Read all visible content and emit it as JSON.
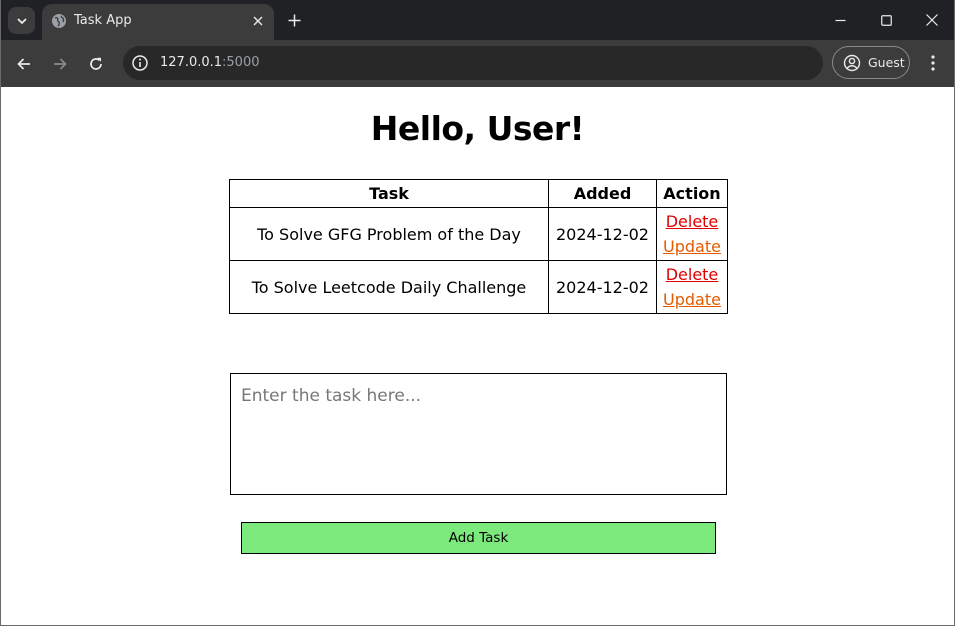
{
  "browser": {
    "tab": {
      "title": "Task App"
    },
    "address_bar": {
      "host": "127.0.0.1",
      "port": ":5000"
    },
    "profile": {
      "label": "Guest"
    }
  },
  "page": {
    "heading": "Hello, User!",
    "table": {
      "headers": [
        "Task",
        "Added",
        "Action"
      ],
      "rows": [
        {
          "task": "To Solve GFG Problem of the Day",
          "added": "2024-12-02",
          "delete_label": "Delete",
          "update_label": "Update"
        },
        {
          "task": "To Solve Leetcode Daily Challenge",
          "added": "2024-12-02",
          "delete_label": "Delete",
          "update_label": "Update"
        }
      ]
    },
    "form": {
      "task_placeholder": "Enter the task here...",
      "task_value": "",
      "submit_label": "Add Task"
    }
  },
  "colors": {
    "delete_link": "#e00000",
    "update_link": "#e35a00",
    "add_button": "#7ce97c",
    "browser_frame": "#202124",
    "browser_toolbar": "#3c3c3c"
  },
  "icons": [
    "tab-search-icon",
    "globe-icon",
    "close-icon",
    "plus-icon",
    "minimize-icon",
    "maximize-icon",
    "window-close-icon",
    "back-arrow-icon",
    "forward-arrow-icon",
    "reload-icon",
    "info-icon",
    "profile-icon",
    "kebab-menu-icon"
  ]
}
